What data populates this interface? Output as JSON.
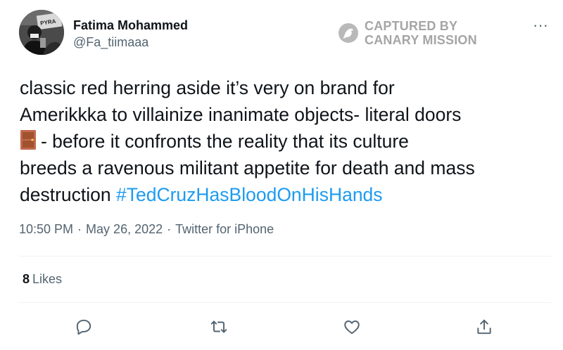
{
  "author": {
    "name": "Fatima Mohammed",
    "handle": "@Fa_tiimaaa",
    "avatar_sign_text": "PYRA"
  },
  "watermark": {
    "line1": "CAPTURED BY",
    "line2": "CANARY MISSION"
  },
  "more_label": "···",
  "tweet": {
    "line1": "classic red herring aside it’s very on brand for",
    "line2": "Amerikkka to villainize inanimate objects-   literal doors",
    "line3_after_emoji": "- before it confronts the reality that its culture",
    "line4": "breeds a ravenous militant appetite for death and mass",
    "line5_text": "destruction ",
    "hashtag": "#TedCruzHasBloodOnHisHands",
    "emoji_name": "door-emoji"
  },
  "meta": {
    "time": "10:50 PM",
    "date": "May 26, 2022",
    "source": "Twitter for iPhone",
    "separator": "·"
  },
  "stats": {
    "likes_count": "8",
    "likes_label": "Likes"
  },
  "actions": {
    "reply_icon": "reply-icon",
    "retweet_icon": "retweet-icon",
    "like_icon": "heart-icon",
    "share_icon": "share-icon"
  },
  "colors": {
    "text": "#0f1419",
    "secondary": "#536471",
    "hashtag": "#1d9bf0",
    "divider": "#eff3f4",
    "watermark": "#a5a5a5"
  }
}
